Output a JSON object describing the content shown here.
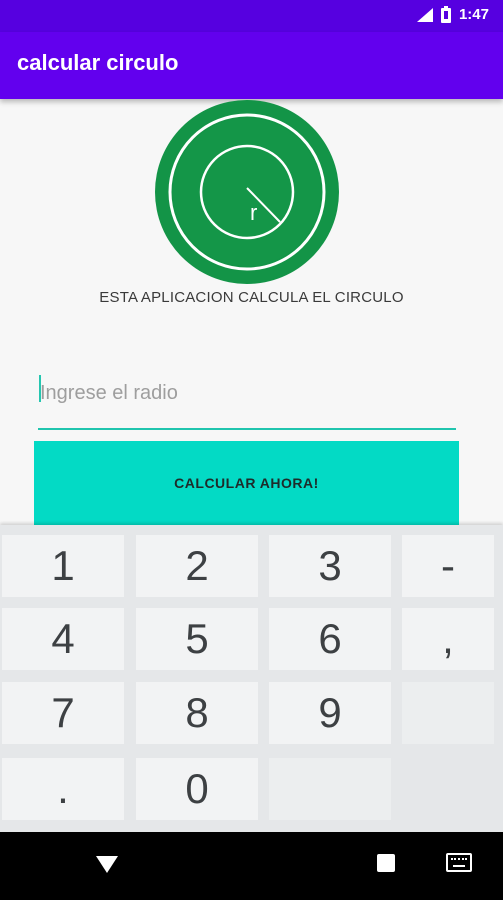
{
  "status_bar": {
    "time": "1:47"
  },
  "app_bar": {
    "title": "calcular circulo"
  },
  "logo": {
    "label": "r",
    "outer_color": "#139447",
    "inner_color": "#149648"
  },
  "description": "ESTA APLICACION CALCULA EL CIRCULO",
  "radius_input": {
    "placeholder": "Ingrese el radio",
    "value": ""
  },
  "calculate_button": {
    "label": "CALCULAR AHORA!",
    "color": "#03dac5"
  },
  "keyboard": {
    "keys": [
      "1",
      "2",
      "3",
      "-",
      "4",
      "5",
      "6",
      ",",
      "7",
      "8",
      "9",
      "",
      ".",
      "0",
      ""
    ]
  },
  "colors": {
    "primary": "#6200ee",
    "primary_dark": "#5600e0",
    "accent": "#03dac5"
  }
}
